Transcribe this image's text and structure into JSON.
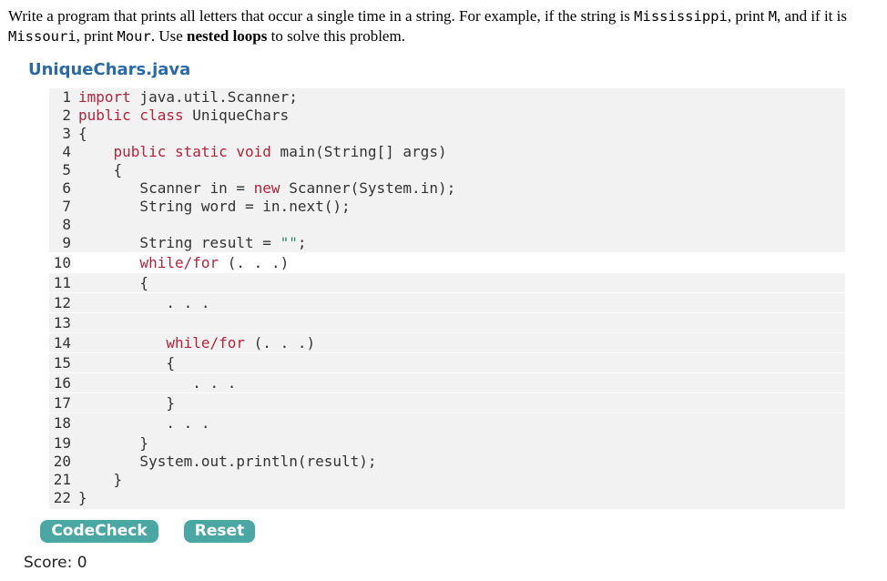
{
  "prompt": {
    "p1": "Write a program that prints all letters that occur a single time in a string. For example, if the string is ",
    "ex1": "Mississippi",
    "p2": ", print ",
    "ans1": "M",
    "p3": ", and if it is ",
    "ex2": "Missouri",
    "p4": ", print ",
    "ans2": "Mour",
    "p5": ". Use ",
    "bold": "nested loops",
    "p6": " to solve this problem."
  },
  "file": {
    "name": "UniqueChars.java"
  },
  "code": {
    "l1": {
      "n": "1",
      "kw": "import",
      "rest": " java.util.Scanner;"
    },
    "l2": {
      "n": "2",
      "kw": "public class",
      "rest": " UniqueChars"
    },
    "l3": {
      "n": "3",
      "rest": "{"
    },
    "l4": {
      "n": "4",
      "pre": "    ",
      "kw": "public static void",
      "rest": " main(String[] args)"
    },
    "l5": {
      "n": "5",
      "rest": "    {"
    },
    "l6": {
      "n": "6",
      "pre": "       Scanner in = ",
      "kw": "new",
      "rest": " Scanner(System.in);"
    },
    "l7": {
      "n": "7",
      "rest": "       String word = in.next();"
    },
    "l8": {
      "n": "8",
      "rest": ""
    },
    "l9": {
      "n": "9",
      "pre": "       String result = ",
      "str": "\"\"",
      "rest": ";"
    },
    "l10": {
      "n": "10",
      "pre": "       ",
      "kw": "while/for",
      "rest": " (. . .)"
    },
    "l11": {
      "n": "11",
      "rest": "       {"
    },
    "l12": {
      "n": "12",
      "rest": "          . . ."
    },
    "l13": {
      "n": "13",
      "rest": ""
    },
    "l14": {
      "n": "14",
      "pre": "          ",
      "kw": "while/for",
      "rest": " (. . .)"
    },
    "l15": {
      "n": "15",
      "rest": "          {"
    },
    "l16": {
      "n": "16",
      "rest": "             . . ."
    },
    "l17": {
      "n": "17",
      "rest": "          }"
    },
    "l18": {
      "n": "18",
      "rest": "          . . ."
    },
    "l19": {
      "n": "19",
      "rest": "       }"
    },
    "l20": {
      "n": "20",
      "rest": "       System.out.println(result);"
    },
    "l21": {
      "n": "21",
      "rest": "    }"
    },
    "l22": {
      "n": "22",
      "rest": "}"
    }
  },
  "buttons": {
    "codecheck": "CodeCheck",
    "reset": "Reset"
  },
  "score": {
    "label": "Score: 0"
  },
  "colors": {
    "button": "#4aa7a3",
    "filename": "#2a6aa8",
    "keyword": "#b3243d",
    "string": "#2d8f6e",
    "editor_bg": "#f2f2f2"
  }
}
